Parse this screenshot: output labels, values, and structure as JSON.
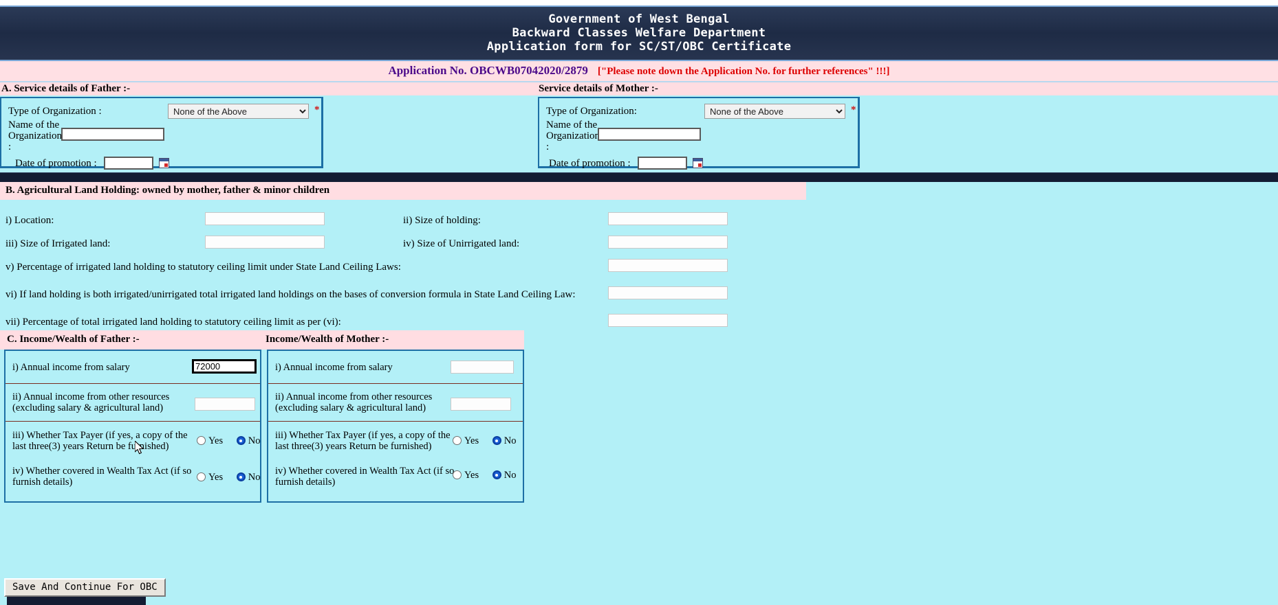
{
  "banner": {
    "line1": "Government of West Bengal",
    "line2": "Backward Classes Welfare Department",
    "line3": "Application form for SC/ST/OBC Certificate"
  },
  "application": {
    "number_label": "Application No. OBCWB07042020/2879",
    "note": "[\"Please note down the Application No. for further references\" !!!]",
    "number_color": "#4b0a8a",
    "note_color": "#dd0000"
  },
  "section_a": {
    "father_heading": "A. Service details of Father :-",
    "mother_heading": "Service details of Mother :-",
    "father": {
      "org_type_label": "Type of Organization :",
      "org_type_value": "None of the Above",
      "org_type_options": [
        "None of the Above"
      ],
      "required_mark": "*",
      "org_name_label": "Name of the Organization :",
      "org_name_value": "",
      "promotion_label": "Date of promotion :",
      "promotion_value": ""
    },
    "mother": {
      "org_type_label": "Type of Organization:",
      "org_type_value": "None of the Above",
      "org_type_options": [
        "None of the Above"
      ],
      "required_mark": "*",
      "org_name_label": "Name of the Organization :",
      "org_name_value": "",
      "promotion_label": "Date of promotion :",
      "promotion_value": ""
    }
  },
  "section_b": {
    "heading": "B. Agricultural Land Holding: owned by mother, father & minor children",
    "fields": [
      {
        "key": "i",
        "label": "i) Location:",
        "value": ""
      },
      {
        "key": "ii",
        "label": "ii) Size of holding:",
        "value": ""
      },
      {
        "key": "iii",
        "label": "iii) Size of Irrigated land:",
        "value": ""
      },
      {
        "key": "iv",
        "label": "iv) Size of Unirrigated land:",
        "value": ""
      },
      {
        "key": "v",
        "label": "v) Percentage of irrigated land holding to statutory ceiling limit under State Land Ceiling Laws:",
        "value": ""
      },
      {
        "key": "vi",
        "label": "vi) If land holding is both irrigated/unirrigated total irrigated land holdings on the bases of conversion formula in State Land Ceiling Law:",
        "value": ""
      },
      {
        "key": "vii",
        "label": "vii) Percentage of total irrigated land holding to statutory ceiling limit as per (vi):",
        "value": ""
      }
    ]
  },
  "section_c": {
    "father_heading": "C. Income/Wealth of Father :-",
    "mother_heading": "Income/Wealth of Mother :-",
    "father": {
      "salary_label": "i) Annual income from salary",
      "salary_value": "72000",
      "other_label_line1": "ii) Annual income from other resources",
      "other_label_line2": "(excluding salary & agricultural land)",
      "other_value": "",
      "taxpayer_label_line1": "iii) Whether Tax Payer (if yes, a copy of the",
      "taxpayer_label_line2": "last three(3) years Return be furnished)",
      "taxpayer_selected": "No",
      "wealth_label_line1": "iv) Whether covered in Wealth Tax Act (if so",
      "wealth_label_line2": "furnish details)",
      "wealth_selected": "No"
    },
    "mother": {
      "salary_label": "i) Annual income from salary",
      "salary_value": "",
      "other_label_line1": "ii) Annual income from other resources",
      "other_label_line2": "(excluding salary & agricultural land)",
      "other_value": "",
      "taxpayer_label_line1": "iii) Whether Tax Payer (if yes, a copy of the",
      "taxpayer_label_line2": "last three(3) years Return be furnished)",
      "taxpayer_selected": "No",
      "wealth_label_line1": "iv) Whether covered in Wealth Tax Act (if so",
      "wealth_label_line2": "furnish details)",
      "wealth_selected": "No"
    },
    "radio_yes": "Yes",
    "radio_no": "No"
  },
  "footer": {
    "save_button": "Save And Continue For OBC"
  }
}
